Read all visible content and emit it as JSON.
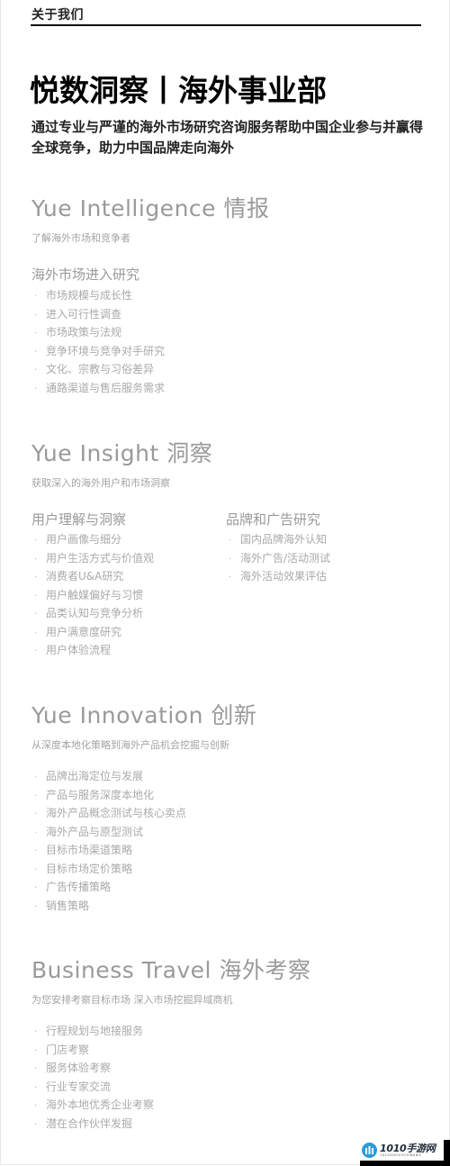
{
  "header": {
    "label": "关于我们"
  },
  "title": "悦数洞察丨海外事业部",
  "intro": "通过专业与严谨的海外市场研究咨询服务帮助中国企业参与并赢得全球竞争，助力中国品牌走向海外",
  "sections": [
    {
      "title": "Yue Intelligence 情报",
      "subtitle": "了解海外市场和竞争者",
      "groups": [
        {
          "title": "海外市场进入研究",
          "items": [
            "市场规模与成长性",
            "进入可行性调查",
            "市场政策与法规",
            "竞争环境与竞争对手研究",
            "文化、宗教与习俗差异",
            "通路渠道与售后服务需求"
          ]
        }
      ]
    },
    {
      "title": "Yue Insight 洞察",
      "subtitle": "获取深入的海外用户和市场洞察",
      "groups": [
        {
          "title": "用户理解与洞察",
          "items": [
            "用户画像与细分",
            "用户生活方式与价值观",
            "消费者U&A研究",
            "用户触媒偏好与习惯",
            "品类认知与竞争分析",
            "用户满意度研究",
            "用户体验流程"
          ]
        },
        {
          "title": "品牌和广告研究",
          "items": [
            "国内品牌海外认知",
            "海外广告/活动测试",
            "海外活动效果评估"
          ]
        }
      ]
    },
    {
      "title": "Yue Innovation 创新",
      "subtitle": "从深度本地化策略到海外产品机会挖掘与创新",
      "groups": [
        {
          "title": "",
          "items": [
            "品牌出海定位与发展",
            "产品与服务深度本地化",
            "海外产品概念测试与核心卖点",
            "海外产品与原型测试",
            "目标市场渠道策略",
            "目标市场定价策略",
            "广告传播策略",
            "销售策略"
          ]
        }
      ]
    },
    {
      "title": "Business Travel 海外考察",
      "subtitle": "为您安排考察目标市场 深入市场挖掘异域商机",
      "groups": [
        {
          "title": "",
          "items": [
            "行程规划与地接服务",
            "门店考察",
            "服务体验考察",
            "行业专家交流",
            "海外本地优秀企业考察",
            "潜在合作伙伴发掘"
          ]
        }
      ]
    }
  ],
  "bullet_glyph": "·",
  "watermark": {
    "brand": "1010手游网",
    "sub": "1010SHOUYOUWANG",
    "icon": "game-logo-icon",
    "logo_color": "#2d9bd8"
  },
  "colors": {
    "title": "#000000",
    "section_title": "#9a9a9a",
    "list_text": "#aaaaaa"
  }
}
